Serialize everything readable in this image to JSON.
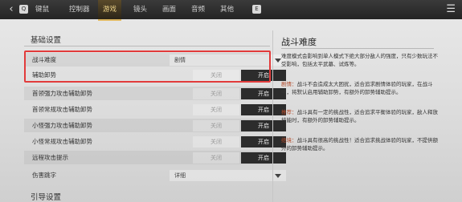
{
  "topbar": {
    "tabs": [
      "键鼠",
      "控制器",
      "游戏",
      "镜头",
      "画面",
      "音频",
      "其他"
    ],
    "active_tab": "游戏",
    "left_key": "Q",
    "right_key": "E"
  },
  "basic": {
    "section_title": "基础设置",
    "rows": [
      {
        "label": "战斗难度",
        "type": "select",
        "value": "剧情"
      },
      {
        "label": "辅助卸势",
        "type": "toggle",
        "off": "关闭",
        "on": "开启"
      },
      {
        "label": "首领强力攻击辅助卸势",
        "type": "toggle",
        "off": "关闭",
        "on": "开启"
      },
      {
        "label": "首领常规攻击辅助卸势",
        "type": "toggle",
        "off": "关闭",
        "on": "开启"
      },
      {
        "label": "小怪强力攻击辅助卸势",
        "type": "toggle",
        "off": "关闭",
        "on": "开启"
      },
      {
        "label": "小怪常规攻击辅助卸势",
        "type": "toggle",
        "off": "关闭",
        "on": "开启"
      },
      {
        "label": "远程攻击提示",
        "type": "toggle",
        "off": "关闭",
        "on": "开启"
      },
      {
        "label": "伤害跳字",
        "type": "select",
        "value": "详细"
      }
    ]
  },
  "guide": {
    "section_title": "引导设置"
  },
  "info": {
    "title": "战斗难度",
    "intro": "难度模式会影响到单人模式下绝大部分敌人的强度，只有少数玩法不受影响，包括太平武墓、试炼等。",
    "entries": [
      {
        "tag": "剧情：",
        "text": "战斗不会造成太大困扰，适合追求剧情体验的玩家，在战斗中，将默认启用辅助卸势，有额外的卸势辅助提示。"
      },
      {
        "tag": "推荐：",
        "text": "战斗具有一定的挑战性，适合追求平衡体验的玩家，敌人释放技能时，有额外的卸势辅助提示。"
      },
      {
        "tag": "绝境：",
        "text": "战斗具有很高的挑战性！适合追求挑战体验的玩家，不提供额外的卸势辅助提示。"
      }
    ]
  }
}
